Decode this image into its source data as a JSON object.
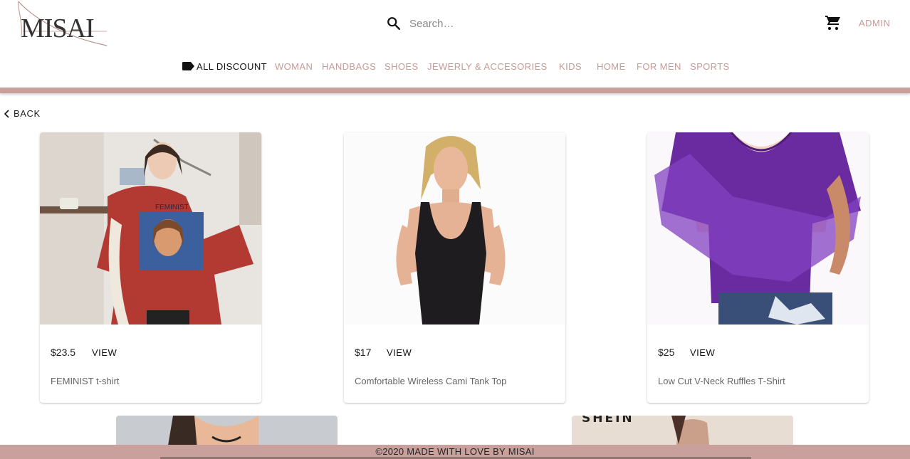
{
  "brand": {
    "logo_text": "MISAI"
  },
  "search": {
    "placeholder": "Search…"
  },
  "header": {
    "admin_label": "ADMIN"
  },
  "nav": {
    "items": [
      {
        "label": "ALL DISCOUNT",
        "active": true
      },
      {
        "label": "WOMAN"
      },
      {
        "label": "HANDBAGS"
      },
      {
        "label": "SHOES"
      },
      {
        "label": "JEWERLY & ACCESORIES"
      },
      {
        "label": "KIDS"
      },
      {
        "label": "HOME"
      },
      {
        "label": "FOR MEN"
      },
      {
        "label": "SPORTS"
      }
    ]
  },
  "back_label": "BACK",
  "products": [
    {
      "price": "$23.5",
      "view_label": "VIEW",
      "title": "FEMINIST t-shirt"
    },
    {
      "price": "$17",
      "view_label": "VIEW",
      "title": "Comfortable Wireless Cami Tank Top"
    },
    {
      "price": "$25",
      "view_label": "VIEW",
      "title": "Low Cut V-Neck Ruffles T-Shirt"
    }
  ],
  "partial_products": [
    {
      "brand_text": ""
    },
    {
      "brand_text": "SHEIN"
    }
  ],
  "footer": {
    "text": "©2020 MADE WITH LOVE BY MISAI"
  },
  "colors": {
    "accent": "#c49b98",
    "footer_bg": "#c9a09b",
    "shirt_red": "#b33a33",
    "top_purple": "#6a2aa0"
  },
  "icons": [
    "search-icon",
    "cart-icon",
    "tag-icon",
    "chevron-left-icon"
  ]
}
